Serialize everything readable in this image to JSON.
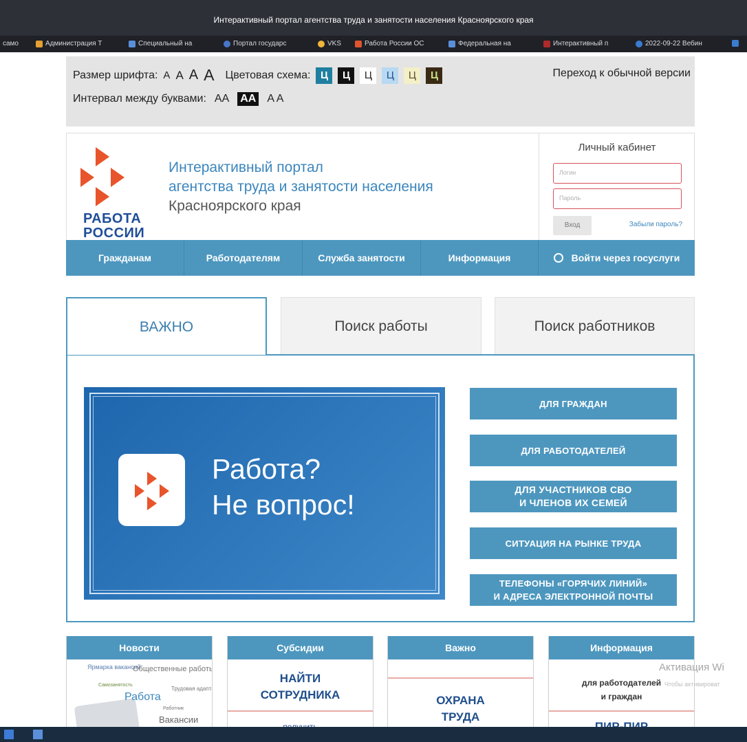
{
  "window": {
    "title": "Интерактивный портал агентства труда и занятости населения Красноярского края"
  },
  "bookmarks": [
    {
      "label": "само",
      "color": "#1f2127"
    },
    {
      "label": "Администрация Т",
      "color": "#e4a031"
    },
    {
      "label": "Специальный на",
      "color": "#5a8fd8"
    },
    {
      "label": "Портал государс",
      "color": "#4a76c8"
    },
    {
      "label": "VKS",
      "color": "#f0b53a"
    },
    {
      "label": "Работа России ОС",
      "color": "#e0542e"
    },
    {
      "label": "Федеральная на",
      "color": "#5a8fd8"
    },
    {
      "label": "Интерактивный п",
      "color": "#b02a2a"
    },
    {
      "label": "2022-09-22 Вебин",
      "color": "#3b7bd0"
    }
  ],
  "accessibility": {
    "font_size_label": "Размер шрифта:",
    "font_sizes": [
      "A",
      "A",
      "A",
      "A"
    ],
    "color_scheme_label": "Цветовая схема:",
    "color_schemes": [
      {
        "label": "Ц",
        "bg": "#1f7fa0",
        "fg": "#ffffff"
      },
      {
        "label": "Ц",
        "bg": "#111111",
        "fg": "#ffffff"
      },
      {
        "label": "Ц",
        "bg": "#ffffff",
        "fg": "#222222"
      },
      {
        "label": "Ц",
        "bg": "#b7d9f2",
        "fg": "#1f4e8c"
      },
      {
        "label": "Ц",
        "bg": "#f3efc7",
        "fg": "#5a4b2a"
      },
      {
        "label": "Ц",
        "bg": "#3a2a14",
        "fg": "#c9e28a"
      }
    ],
    "spacing_label": "Интервал между буквами:",
    "spacing": [
      "AA",
      "AA",
      "A A"
    ],
    "normal_version": "Переход к обычной версии"
  },
  "header": {
    "logo_text_1": "РАБОТА",
    "logo_text_2": "РОССИИ",
    "portal_line1": "Интерактивный портал",
    "portal_line2": "агентства труда и занятости населения",
    "portal_line3": "Красноярского края",
    "brand_colors": {
      "logo_red": "#e8542b",
      "logo_blue": "#1f4e99"
    }
  },
  "cabinet": {
    "title": "Личный кабинет",
    "login_placeholder": "Логин",
    "password_placeholder": "Пароль",
    "enter": "Вход",
    "forgot": "Забыли пароль?"
  },
  "nav": {
    "items": [
      "Гражданам",
      "Работодателям",
      "Служба занятости",
      "Информация"
    ],
    "gosuslugi": "Войти через госуслуги"
  },
  "tabs": [
    "ВАЖНО",
    "Поиск работы",
    "Поиск работников"
  ],
  "banner": {
    "line1": "Работа?",
    "line2": "Не вопрос!"
  },
  "side_buttons": [
    {
      "l1": "ДЛЯ ГРАЖДАН",
      "l2": ""
    },
    {
      "l1": "ДЛЯ РАБОТОДАТЕЛЕЙ",
      "l2": ""
    },
    {
      "l1": "ДЛЯ УЧАСТНИКОВ СВО",
      "l2": "И ЧЛЕНОВ ИХ СЕМЕЙ"
    },
    {
      "l1": "СИТУАЦИЯ НА РЫНКЕ ТРУДА",
      "l2": ""
    },
    {
      "l1": "ТЕЛЕФОНЫ «ГОРЯЧИХ ЛИНИЙ»",
      "l2": "И АДРЕСА ЭЛЕКТРОННОЙ ПОЧТЫ"
    }
  ],
  "blocks": {
    "news": {
      "title": "Новости",
      "words": [
        "Ярмарка вакансий",
        "Общественные работы",
        "Самозанятость",
        "Трудовая адаптация",
        "Работа",
        "Работник",
        "Вакансии"
      ]
    },
    "subsidies": {
      "title": "Субсидии",
      "big1": "НАЙТИ",
      "big2": "СОТРУДНИКА",
      "small": "получить"
    },
    "important": {
      "title": "Важно",
      "big1": "ОХРАНА",
      "big2": "ТРУДА"
    },
    "info": {
      "title": "Информация",
      "l1": "для работодателей",
      "l2": "и граждан",
      "bottom": "ПИР-ПИР"
    }
  },
  "watermark": {
    "line1": "Активация Wi",
    "line2": "Чтобы активироват"
  }
}
